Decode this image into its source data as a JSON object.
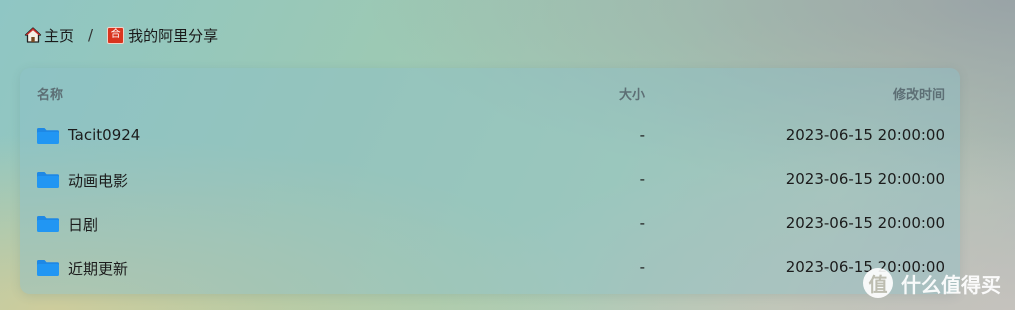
{
  "breadcrumb": {
    "home_label": "主页",
    "separator": "/",
    "current_label": "我的阿里分享",
    "share_icon_char": "合"
  },
  "table": {
    "headers": {
      "name": "名称",
      "size": "大小",
      "modified": "修改时间"
    },
    "rows": [
      {
        "name": "Tacit0924",
        "size": "-",
        "modified": "2023-06-15 20:00:00",
        "icon": "folder-icon"
      },
      {
        "name": "动画电影",
        "size": "-",
        "modified": "2023-06-15 20:00:00",
        "icon": "folder-icon"
      },
      {
        "name": "日剧",
        "size": "-",
        "modified": "2023-06-15 20:00:00",
        "icon": "folder-icon"
      },
      {
        "name": "近期更新",
        "size": "-",
        "modified": "2023-06-15 20:00:00",
        "icon": "folder-icon"
      }
    ]
  },
  "watermark": {
    "badge": "值",
    "text": "什么值得买"
  },
  "colors": {
    "folder": "#2196f3",
    "share_icon_bg": "#d9341e"
  }
}
